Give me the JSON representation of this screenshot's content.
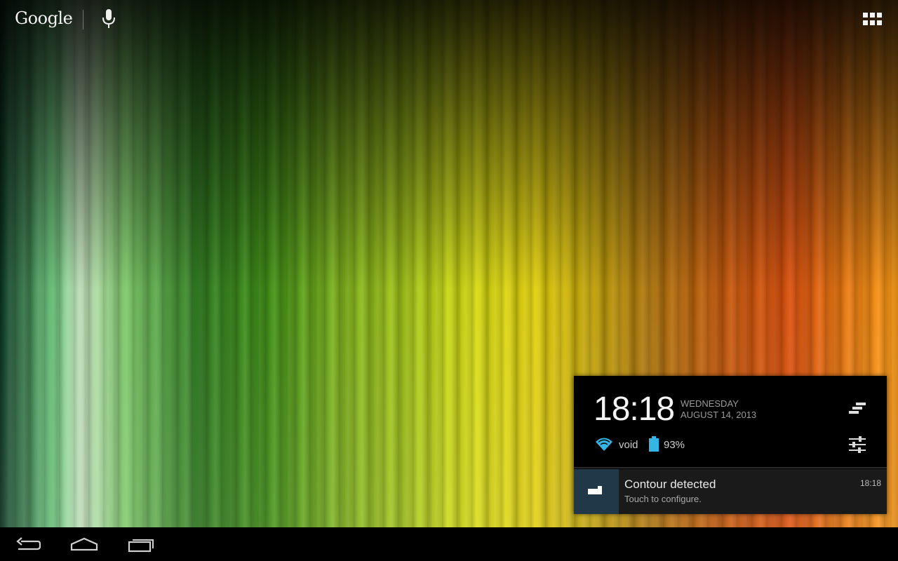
{
  "launcher": {
    "search_logo": "Google",
    "icons": {
      "mic": "microphone-icon",
      "apps": "app-drawer-icon"
    }
  },
  "notification_panel": {
    "time": "18:18",
    "weekday": "WEDNESDAY",
    "date": "AUGUST 14, 2013",
    "wifi": {
      "icon": "wifi-icon",
      "label": "void"
    },
    "battery": {
      "icon": "battery-icon",
      "label": "93%"
    },
    "icons": {
      "clear_all": "clear-all-icon",
      "settings": "quick-settings-icon"
    },
    "notifications": [
      {
        "icon": "contour-app-icon",
        "title": "Contour detected",
        "text": "Touch to configure.",
        "time": "18:18"
      }
    ]
  },
  "navbar": {
    "icons": {
      "back": "back-icon",
      "home": "home-icon",
      "recents": "recents-icon"
    }
  },
  "colors": {
    "accent_blue": "#33b5e5",
    "panel_bg": "#000000",
    "notification_bg": "#1a1a1a",
    "notification_icon_bg": "#203848"
  }
}
